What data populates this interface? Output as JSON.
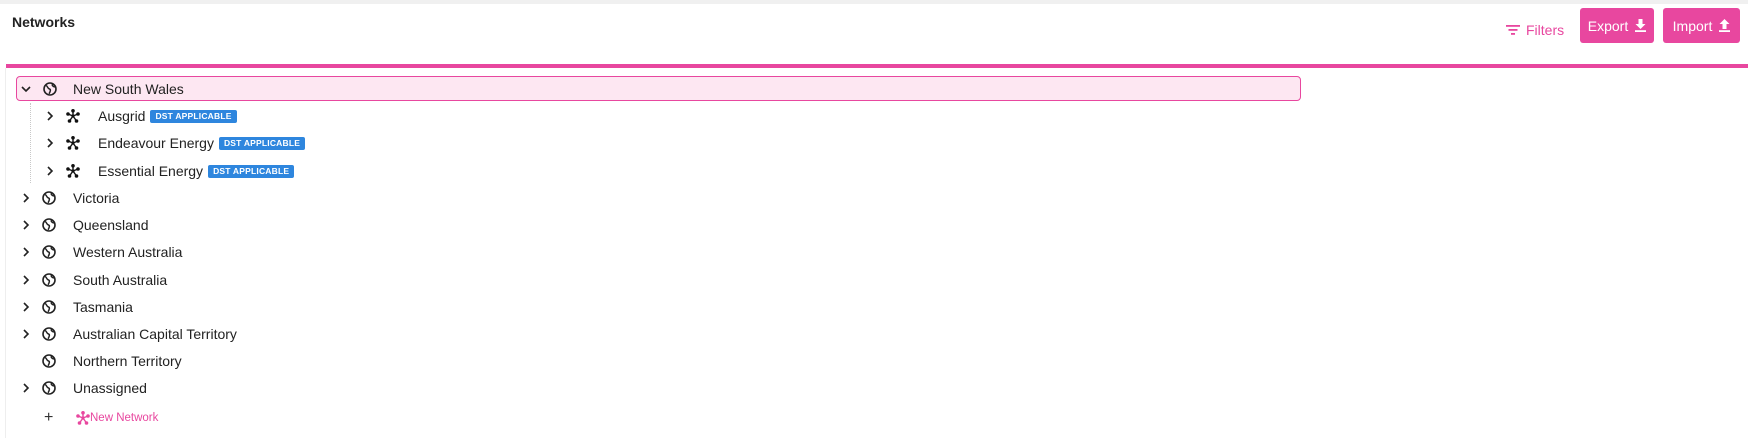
{
  "page": {
    "title": "Networks"
  },
  "toolbar": {
    "filters_label": "Filters",
    "export_label": "Export",
    "import_label": "Import"
  },
  "colors": {
    "accent": "#e8479f",
    "badge": "#2e86de",
    "selected_bg": "#fde7f2"
  },
  "tree": {
    "regions": [
      {
        "label": "New South Wales",
        "expanded": true,
        "selected": true,
        "networks": [
          {
            "label": "Ausgrid",
            "badge": "DST APPLICABLE"
          },
          {
            "label": "Endeavour Energy",
            "badge": "DST APPLICABLE"
          },
          {
            "label": "Essential Energy",
            "badge": "DST APPLICABLE"
          }
        ]
      },
      {
        "label": "Victoria",
        "expandable": true
      },
      {
        "label": "Queensland",
        "expandable": true
      },
      {
        "label": "Western Australia",
        "expandable": true
      },
      {
        "label": "South Australia",
        "expandable": true
      },
      {
        "label": "Tasmania",
        "expandable": true
      },
      {
        "label": "Australian Capital Territory",
        "expandable": true
      },
      {
        "label": "Northern Territory",
        "expandable": false
      },
      {
        "label": "Unassigned",
        "expandable": true
      }
    ],
    "new_network_label": "New Network"
  },
  "icons": {
    "region": "globe-icon",
    "network": "network-icon",
    "expand": "chevron-right-icon",
    "collapse": "chevron-down-icon",
    "filters": "filter-icon",
    "export": "download-icon",
    "import": "upload-icon",
    "add": "plus-icon"
  }
}
